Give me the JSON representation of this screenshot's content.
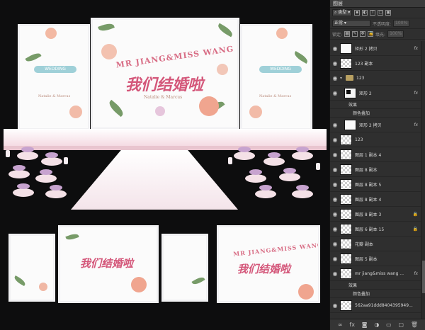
{
  "panel": {
    "tab": "图层",
    "filter_kind": "类型",
    "blend_mode": "正常",
    "opacity_label": "不透明度:",
    "opacity_value": "100%",
    "lock_label": "锁定:",
    "fill_label": "填充:",
    "fill_value": "100%",
    "layers": [
      {
        "name": "矩形 2 拷贝",
        "thumb": "white",
        "fx": "fx",
        "indent": 0
      },
      {
        "name": "123 副本",
        "thumb": "checker",
        "indent": 0
      },
      {
        "name": "123",
        "type": "group",
        "indent": 0
      },
      {
        "name": "矩形 2",
        "thumb": "mask",
        "fx": "fx",
        "indent": 1
      },
      {
        "name": "效果",
        "type": "effect",
        "indent": 2
      },
      {
        "name": "颜色叠加",
        "type": "effect",
        "indent": 3
      },
      {
        "name": "矩形 2 拷贝",
        "thumb": "white",
        "fx": "fx",
        "indent": 1
      },
      {
        "name": "123",
        "thumb": "checker",
        "indent": 0
      },
      {
        "name": "图层 1 副本 4",
        "thumb": "checker",
        "indent": 0
      },
      {
        "name": "图层 8 副本",
        "thumb": "checker",
        "indent": 0
      },
      {
        "name": "图层 8 副本 5",
        "thumb": "checker",
        "indent": 0
      },
      {
        "name": "图层 8 副本 4",
        "thumb": "checker",
        "indent": 0
      },
      {
        "name": "图层 8 副本 3",
        "thumb": "checker",
        "lock": true,
        "indent": 0
      },
      {
        "name": "图层 6 副本 15",
        "thumb": "checker",
        "lock": true,
        "indent": 0
      },
      {
        "name": "花瓣 副本",
        "thumb": "checker",
        "indent": 0
      },
      {
        "name": "图层 5 副本",
        "thumb": "checker",
        "indent": 0
      },
      {
        "name": "mr jiang&miss wang ...",
        "thumb": "checker",
        "fx": "fx",
        "indent": 0
      },
      {
        "name": "效果",
        "type": "effect",
        "indent": 2
      },
      {
        "name": "颜色叠加",
        "type": "effect",
        "indent": 3
      },
      {
        "name": "562aa91ddd8404395949...",
        "thumb": "checker",
        "indent": 0
      }
    ]
  },
  "art": {
    "title_en": "MR JIANG&MISS WANG",
    "title_cn": "我们结婚啦",
    "names": "Natalie & Marcus",
    "banner_text": "WEDDING"
  },
  "colors": {
    "canvas_bg": "#0d0d0e",
    "accent_pink": "#d4577a",
    "leaf_green": "#5f8a4e",
    "panel_bg": "#2f2f2f"
  }
}
